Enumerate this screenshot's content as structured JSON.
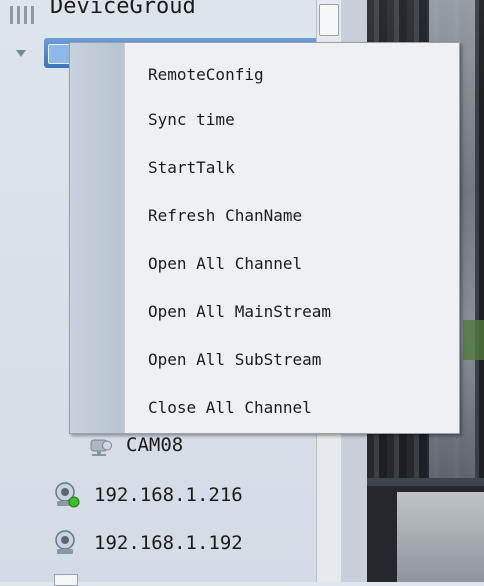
{
  "tree": {
    "group_label": "DeviceGroud",
    "camera_label": "CAM08",
    "hosts": [
      {
        "address": "192.168.1.216",
        "status": "online"
      },
      {
        "address": "192.168.1.192",
        "status": "normal"
      }
    ]
  },
  "context_menu": {
    "items": [
      "RemoteConfig",
      "Sync time",
      "StartTalk",
      "Refresh ChanName",
      "Open All Channel",
      "Open All MainStream",
      "Open All SubStream",
      "Close All Channel"
    ]
  },
  "colors": {
    "selection": "#3c74bb",
    "menu_bg": "#eef0f3",
    "online": "#3bbf2a"
  },
  "icons": [
    "grip-icon",
    "expand-arrow-icon",
    "device-icon",
    "camera-icon",
    "host-online-icon",
    "host-icon"
  ]
}
